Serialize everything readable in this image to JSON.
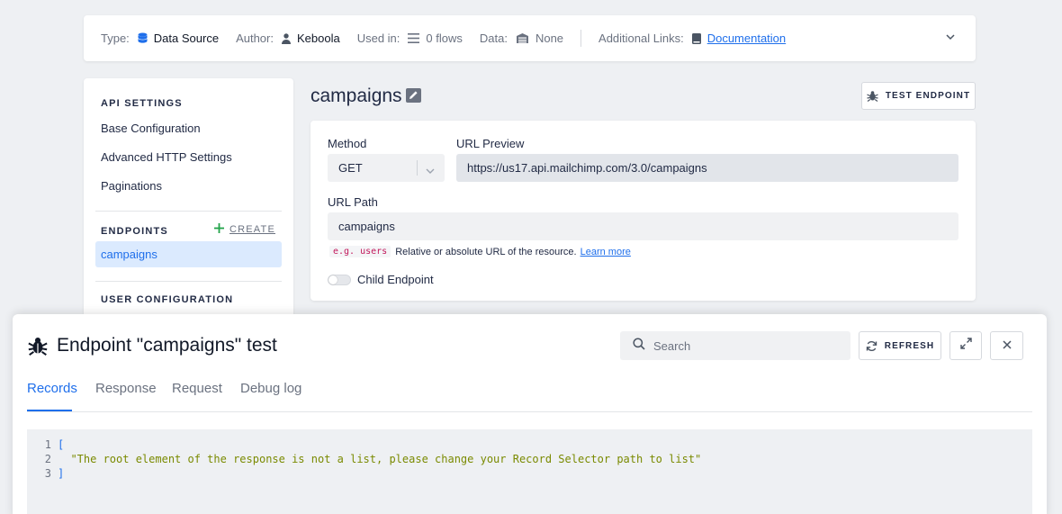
{
  "infobar": {
    "type_label": "Type:",
    "type_value": "Data Source",
    "author_label": "Author:",
    "author_value": "Keboola",
    "used_label": "Used in:",
    "used_value": "0 flows",
    "data_label": "Data:",
    "data_value": "None",
    "links_label": "Additional Links:",
    "doc_link": "Documentation"
  },
  "sidebar": {
    "api_heading": "API SETTINGS",
    "items": [
      "Base Configuration",
      "Advanced HTTP Settings",
      "Paginations"
    ],
    "endpoints_heading": "ENDPOINTS",
    "create_label": "CREATE",
    "endpoints": [
      "campaigns"
    ],
    "user_heading": "USER CONFIGURATION"
  },
  "endpoint": {
    "name": "campaigns",
    "test_button": "TEST ENDPOINT",
    "method_label": "Method",
    "method_value": "GET",
    "url_preview_label": "URL Preview",
    "url_preview_value": "https://us17.api.mailchimp.com/3.0/campaigns",
    "url_path_label": "URL Path",
    "url_path_value": "campaigns",
    "hint_example": "e.g. users",
    "hint_text": "Relative or absolute URL of the resource.",
    "hint_link": "Learn more",
    "child_label": "Child Endpoint",
    "child_enabled": false
  },
  "modal": {
    "title": "Endpoint \"campaigns\" test",
    "search_placeholder": "Search",
    "refresh_label": "REFRESH",
    "tabs": [
      "Records",
      "Response",
      "Request",
      "Debug log"
    ],
    "active_tab": "Records",
    "code_lines": [
      {
        "num": "1",
        "text": "["
      },
      {
        "num": "2",
        "text": "  \"The root element of the response is not a list, please change your Record Selector path to list\""
      },
      {
        "num": "3",
        "text": "]"
      }
    ]
  },
  "colors": {
    "accent": "#1f6feb",
    "string": "#7a8a00",
    "create_plus": "#22a34a"
  }
}
